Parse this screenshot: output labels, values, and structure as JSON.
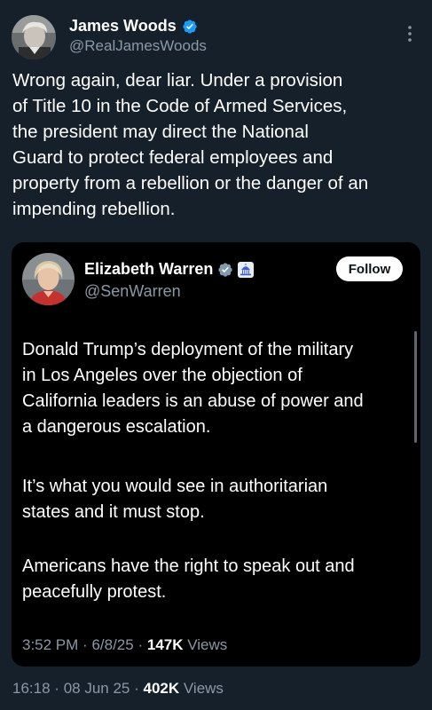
{
  "post": {
    "author": {
      "display_name": "James Woods",
      "handle": "@RealJamesWoods",
      "verified_icon": "verified-badge-icon",
      "avatar_icon": "avatar-photo"
    },
    "text_lines": [
      "Wrong again, dear liar. Under a provision",
      "of Title 10 in the Code of Armed Services,",
      "the president may direct the National",
      "Guard to protect federal employees and",
      "property from a rebellion or the danger of an",
      "impending rebellion."
    ],
    "meta": {
      "time": "16:18",
      "sep1": "·",
      "date": "08 Jun 25",
      "sep2": "·",
      "views_count": "402K",
      "views_label": "Views"
    },
    "more_icon": "more-vertical-icon"
  },
  "quote": {
    "author": {
      "display_name": "Elizabeth Warren",
      "handle": "@SenWarren",
      "verified_icon": "verified-badge-gray-icon",
      "affiliation_icon": "capitol-icon"
    },
    "follow_label": "Follow",
    "paragraphs": [
      [
        "Donald Trump’s deployment of the military",
        "in Los Angeles over the objection of",
        "California leaders is an abuse of power and",
        "a dangerous escalation."
      ],
      [
        "It’s what you would see in authoritarian",
        "states and it must stop."
      ],
      [
        "Americans have the right to speak out and",
        "peacefully protest."
      ]
    ],
    "meta": {
      "time": "3:52 PM",
      "sep1": "·",
      "date": "6/8/25",
      "sep2": "·",
      "views_count": "147K",
      "views_label": "Views"
    }
  },
  "colors": {
    "background": "#15202b",
    "quote_background": "#000000",
    "secondary_text": "#8b98a5",
    "verified_blue": "#1d9bf0"
  }
}
